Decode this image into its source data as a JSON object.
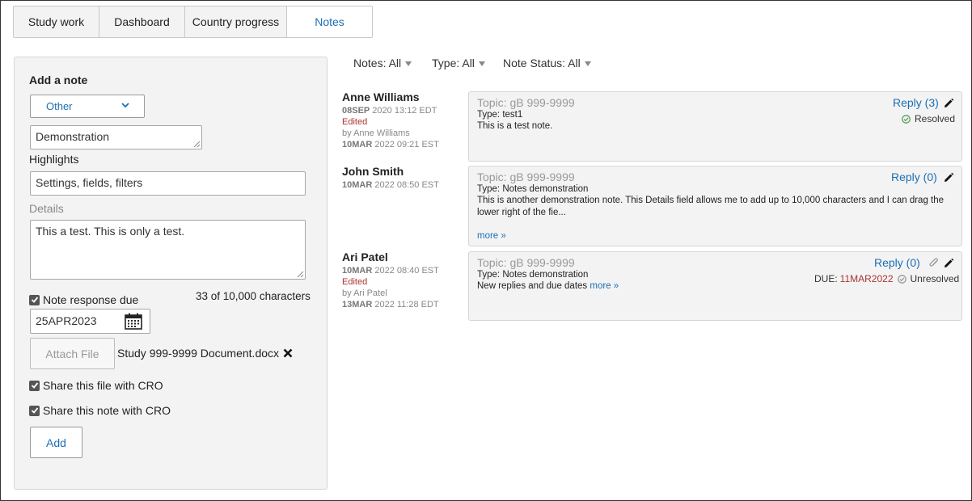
{
  "tabs": [
    {
      "label": "Study work"
    },
    {
      "label": "Dashboard"
    },
    {
      "label": "Country progress"
    },
    {
      "label": "Notes"
    }
  ],
  "add_note": {
    "heading": "Add a note",
    "category": "Other",
    "subject_value": "Demonstration",
    "highlights_label": "Highlights",
    "highlights_value": "Settings, fields, filters",
    "details_label": "Details",
    "details_value": "This a test. This is only a test.",
    "response_due_label": "Note response due",
    "char_count": "33 of 10,000 characters",
    "due_date": "25APR2023",
    "attach_label": "Attach File",
    "attached_file": "Study 999-9999 Document.docx",
    "share_file_label": "Share this file with CRO",
    "share_note_label": "Share this note with CRO",
    "add_label": "Add"
  },
  "filters": {
    "notes": "Notes: All",
    "type": "Type: All",
    "status": "Note Status: All"
  },
  "notes": [
    {
      "author": "Anne Williams",
      "date_day": "08SEP",
      "date_rest": " 2020 13:12 EDT",
      "edited": "Edited",
      "edited_by": "by Anne Williams",
      "edited_day": "10MAR",
      "edited_rest": " 2022 09:21 EST",
      "topic": "Topic: gB 999-9999",
      "type": "Type: test1",
      "body": "This is a test note.",
      "reply": "Reply (3)",
      "status": "Resolved"
    },
    {
      "author": "John Smith",
      "date_day": "10MAR",
      "date_rest": " 2022 08:50 EST",
      "topic": "Topic: gB 999-9999",
      "type": "Type: Notes demonstration",
      "body": "This is another demonstration note. This Details field allows me to add up to 10,000 characters and I can drag the lower right of the fie...",
      "more": "more »",
      "reply": "Reply (0)"
    },
    {
      "author": "Ari Patel",
      "date_day": "10MAR",
      "date_rest": " 2022 08:40 EST",
      "edited": "Edited",
      "edited_by": "by Ari Patel",
      "edited_day": "13MAR",
      "edited_rest": " 2022 11:28 EDT",
      "topic": "Topic: gB 999-9999",
      "type": "Type: Notes demonstration",
      "body": "New replies and due dates",
      "more": "more »",
      "reply": "Reply (0)",
      "due_label": "DUE:",
      "due_date": "11MAR2022",
      "status": "Unresolved"
    }
  ],
  "colors": {
    "accent": "#1a6fb5",
    "edited": "#aa3333",
    "resolved": "#5aa05a",
    "panel": "#f3f3f3"
  },
  "icons": [
    "chevron-down-icon",
    "calendar-icon",
    "remove-icon",
    "pencil-icon",
    "paperclip-icon",
    "check-circle-icon"
  ]
}
